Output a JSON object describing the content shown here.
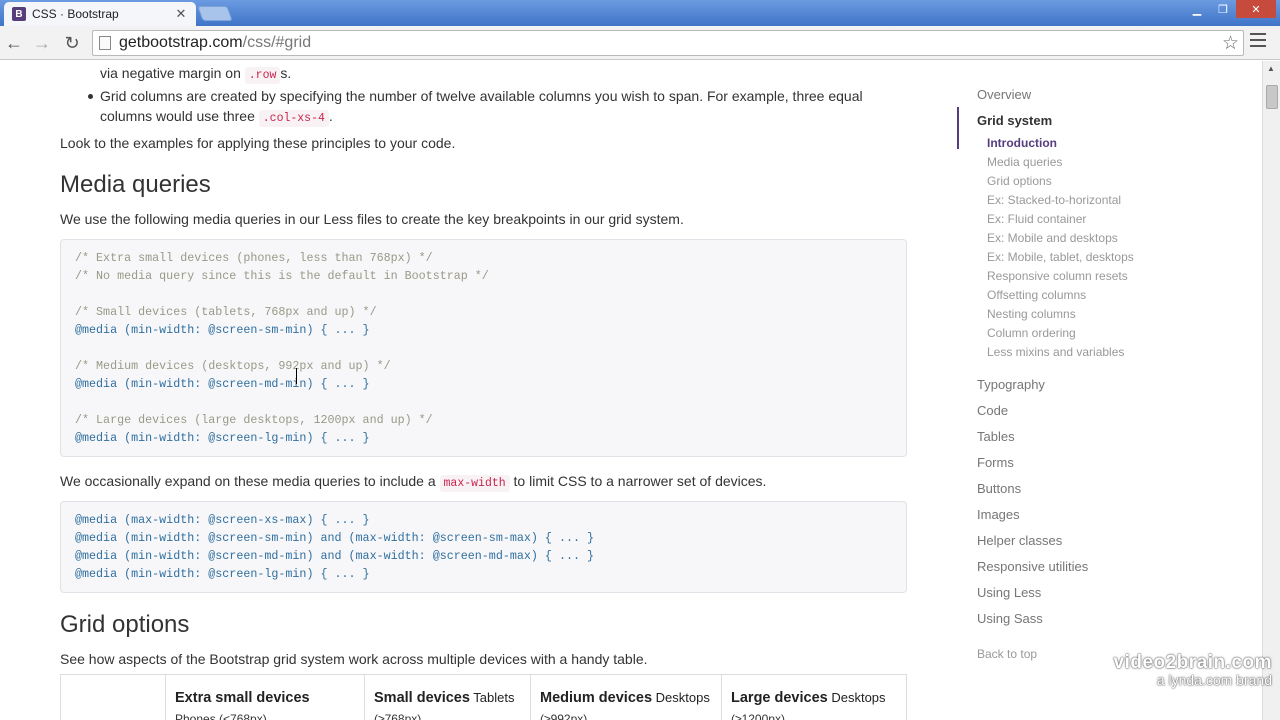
{
  "browser": {
    "tab_title": "CSS · Bootstrap",
    "favicon_letter": "B",
    "url_host": "getbootstrap.com",
    "url_path": "/css/#grid"
  },
  "content": {
    "bullet1_tail_pre": "via negative margin on ",
    "bullet1_code": ".row",
    "bullet1_tail_post": "s.",
    "bullet2_line1": "Grid columns are created by specifying the number of twelve available columns you wish to span. For example, three equal",
    "bullet2_line2_pre": "columns would use three ",
    "bullet2_code": ".col-xs-4",
    "bullet2_line2_post": ".",
    "look_text": "Look to the examples for applying these principles to your code.",
    "media_heading": "Media queries",
    "media_intro": "We use the following media queries in our Less files to create the key breakpoints in our grid system.",
    "code1": {
      "c1": "/* Extra small devices (phones, less than 768px) */",
      "c2": "/* No media query since this is the default in Bootstrap */",
      "c3": "/* Small devices (tablets, 768px and up) */",
      "l3": "@media (min-width: @screen-sm-min) { ... }",
      "c4": "/* Medium devices (desktops, 992px and up) */",
      "l4": "@media (min-width: @screen-md-min) { ... }",
      "c5": "/* Large devices (large desktops, 1200px and up) */",
      "l5": "@media (min-width: @screen-lg-min) { ... }"
    },
    "expand_pre": "We occasionally expand on these media queries to include a ",
    "expand_code": "max-width",
    "expand_post": " to limit CSS to a narrower set of devices.",
    "code2": [
      "@media (max-width: @screen-xs-max) { ... }",
      "@media (min-width: @screen-sm-min) and (max-width: @screen-sm-max) { ... }",
      "@media (min-width: @screen-md-min) and (max-width: @screen-md-max) { ... }",
      "@media (min-width: @screen-lg-min) { ... }"
    ],
    "grid_heading": "Grid options",
    "grid_intro": "See how aspects of the Bootstrap grid system work across multiple devices with a handy table.",
    "table_headers": [
      {
        "bold": "Extra small devices",
        "sub": "",
        "small": "Phones (<768px)"
      },
      {
        "bold": "Small devices",
        "sub": " Tablets",
        "small": "(≥768px)"
      },
      {
        "bold": "Medium devices",
        "sub": " Desktops",
        "small": "(≥992px)"
      },
      {
        "bold": "Large devices",
        "sub": " Desktops",
        "small": "(≥1200px)"
      }
    ]
  },
  "sidenav": {
    "overview": "Overview",
    "grid_system": "Grid system",
    "sub": [
      "Introduction",
      "Media queries",
      "Grid options",
      "Ex: Stacked-to-horizontal",
      "Ex: Fluid container",
      "Ex: Mobile and desktops",
      "Ex: Mobile, tablet, desktops",
      "Responsive column resets",
      "Offsetting columns",
      "Nesting columns",
      "Column ordering",
      "Less mixins and variables"
    ],
    "main": [
      "Typography",
      "Code",
      "Tables",
      "Forms",
      "Buttons",
      "Images",
      "Helper classes",
      "Responsive utilities",
      "Using Less",
      "Using Sass"
    ],
    "back_to_top": "Back to top"
  },
  "watermark": {
    "line1": "video2brain.com",
    "line2": "a lynda.com brand"
  },
  "colors": {
    "bootstrap_purple": "#563d7c",
    "code_red": "#c7254e"
  }
}
